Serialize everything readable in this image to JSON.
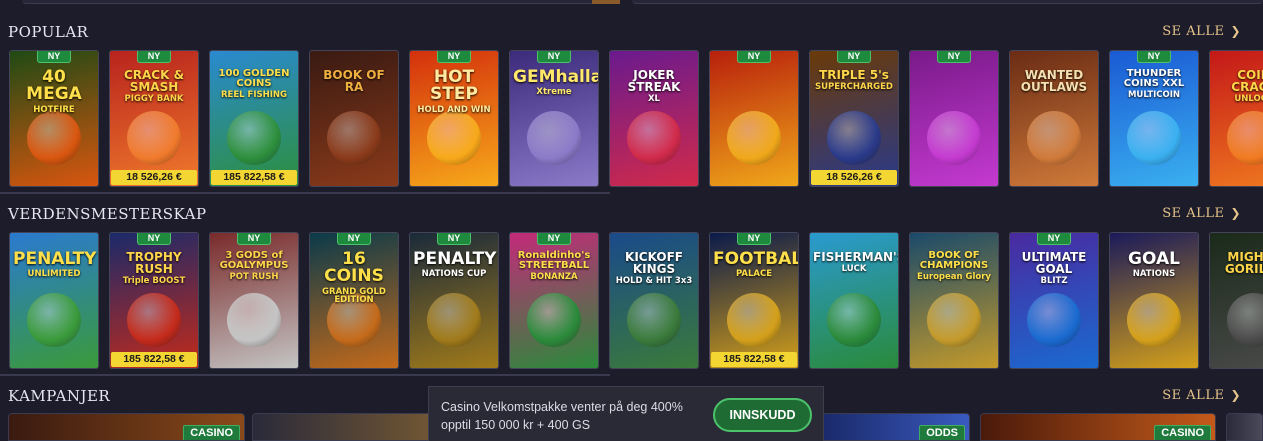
{
  "sections": {
    "popular": {
      "title": "POPULAR",
      "see_all": "SE ALLE"
    },
    "world_cup": {
      "title": "VERDENSMESTERSKAP",
      "see_all": "SE ALLE"
    },
    "promotions": {
      "title": "KAMPANJER",
      "see_all": "SE ALLE"
    }
  },
  "new_badge": "NY",
  "popular_games": [
    {
      "name": "40 MEGA",
      "sub": "HOTFIRE",
      "new": true,
      "jackpot": "",
      "bg": "#1f4a14",
      "bg2": "#d9560f",
      "fg": "#ffe04a"
    },
    {
      "name": "CRACK & SMASH",
      "sub": "PIGGY BANK",
      "new": true,
      "jackpot": "18 526,26 €",
      "bg": "#b8231d",
      "bg2": "#f07a2c",
      "fg": "#ffd64a"
    },
    {
      "name": "100 GOLDEN COINS",
      "sub": "REEL FISHING",
      "new": false,
      "jackpot": "185 822,58 €",
      "bg": "#2a8ad0",
      "bg2": "#2d8f3c",
      "fg": "#ffe04a"
    },
    {
      "name": "BOOK OF RA",
      "sub": "",
      "new": false,
      "jackpot": "",
      "bg": "#3a1a12",
      "bg2": "#8a3a1a",
      "fg": "#f0b040"
    },
    {
      "name": "HOT STEP",
      "sub": "HOLD AND WIN",
      "new": true,
      "jackpot": "",
      "bg": "#d4300c",
      "bg2": "#f7a91a",
      "fg": "#ffeaa0"
    },
    {
      "name": "GEMhalla",
      "sub": "Xtreme",
      "new": true,
      "jackpot": "",
      "bg": "#3c2a7a",
      "bg2": "#8a7ac8",
      "fg": "#ffe86a"
    },
    {
      "name": "JOKER STREAK",
      "sub": "XL",
      "new": false,
      "jackpot": "",
      "bg": "#6a1a8e",
      "bg2": "#d12a4a",
      "fg": "#ffffff"
    },
    {
      "name": "",
      "sub": "",
      "new": true,
      "jackpot": "",
      "bg": "#b8200c",
      "bg2": "#f0a81a",
      "fg": "#ffd64a"
    },
    {
      "name": "TRIPLE 5's",
      "sub": "SUPERCHARGED",
      "new": true,
      "jackpot": "18 526,26 €",
      "bg": "#6a3a08",
      "bg2": "#2a3a8a",
      "fg": "#ffd64a"
    },
    {
      "name": "",
      "sub": "",
      "new": true,
      "jackpot": "",
      "bg": "#7a1a8a",
      "bg2": "#c43ad0",
      "fg": "#ffffff"
    },
    {
      "name": "WANTED OUTLAWS",
      "sub": "",
      "new": false,
      "jackpot": "",
      "bg": "#6a2c14",
      "bg2": "#d07a3a",
      "fg": "#f4e0b0"
    },
    {
      "name": "THUNDER COINS XXL",
      "sub": "MULTICOIN",
      "new": true,
      "jackpot": "",
      "bg": "#1a5ad4",
      "bg2": "#3ab0f0",
      "fg": "#ffffff"
    },
    {
      "name": "COIN CRACK",
      "sub": "UNLOCK",
      "new": false,
      "jackpot": "",
      "bg": "#c41818",
      "bg2": "#f07a20",
      "fg": "#ffd64a"
    }
  ],
  "world_cup_games": [
    {
      "name": "PENALTY",
      "sub": "UNLIMITED",
      "new": false,
      "jackpot": "",
      "bg": "#2a7ad0",
      "bg2": "#3a9a3a",
      "fg": "#ffe04a"
    },
    {
      "name": "TROPHY RUSH",
      "sub": "Triple BOOST",
      "new": true,
      "jackpot": "185 822,58 €",
      "bg": "#1a2a6a",
      "bg2": "#c42a1a",
      "fg": "#ffd64a"
    },
    {
      "name": "3 GODS of GOALYMPUS",
      "sub": "POT RUSH",
      "new": true,
      "jackpot": "",
      "bg": "#7a2a2a",
      "bg2": "#c4c4c4",
      "fg": "#ffd64a"
    },
    {
      "name": "16 COINS",
      "sub": "GRAND GOLD EDITION",
      "new": true,
      "jackpot": "",
      "bg": "#0a3a4a",
      "bg2": "#c46a1a",
      "fg": "#ffe04a"
    },
    {
      "name": "PENALTY",
      "sub": "NATIONS CUP",
      "new": true,
      "jackpot": "",
      "bg": "#1a2a3a",
      "bg2": "#a07a1a",
      "fg": "#ffffff"
    },
    {
      "name": "Ronaldinho's STREETBALL",
      "sub": "BONANZA",
      "new": true,
      "jackpot": "",
      "bg": "#c42a7a",
      "bg2": "#2a8a3a",
      "fg": "#ffe04a"
    },
    {
      "name": "KICKOFF KINGS",
      "sub": "HOLD & HIT 3x3",
      "new": false,
      "jackpot": "",
      "bg": "#1a4a8a",
      "bg2": "#3a7a3a",
      "fg": "#ffffff"
    },
    {
      "name": "FOOTBALL",
      "sub": "PALACE",
      "new": true,
      "jackpot": "185 822,58 €",
      "bg": "#0a1a4a",
      "bg2": "#d4a01a",
      "fg": "#ffe04a"
    },
    {
      "name": "FISHERMAN'S",
      "sub": "LUCK",
      "new": false,
      "jackpot": "",
      "bg": "#2a9ad0",
      "bg2": "#2a8a3a",
      "fg": "#ffffff"
    },
    {
      "name": "BOOK OF CHAMPIONS",
      "sub": "European Glory",
      "new": false,
      "jackpot": "",
      "bg": "#1a4a6a",
      "bg2": "#c49a2a",
      "fg": "#ffe04a"
    },
    {
      "name": "ULTIMATE GOAL",
      "sub": "BLITZ",
      "new": true,
      "jackpot": "",
      "bg": "#4a2aa0",
      "bg2": "#1a6ad0",
      "fg": "#ffffff"
    },
    {
      "name": "GOAL",
      "sub": "NATIONS",
      "new": false,
      "jackpot": "",
      "bg": "#1a1a5a",
      "bg2": "#d4a01a",
      "fg": "#ffffff"
    },
    {
      "name": "MIGHTY GORILLA",
      "sub": "",
      "new": false,
      "jackpot": "",
      "bg": "#1a2a1a",
      "bg2": "#4a4a4a",
      "fg": "#ffd64a"
    }
  ],
  "promotions": [
    {
      "badge": "CASINO",
      "bg": "#3a1a10",
      "bg2": "#8a4a1a"
    },
    {
      "badge": "",
      "bg": "#2a2a3a",
      "bg2": "#c48a2a"
    },
    {
      "badge": "ODDS",
      "bg": "#1a2a6a",
      "bg2": "#3a5ac0"
    },
    {
      "badge": "CASINO",
      "bg": "#4a1a0a",
      "bg2": "#c45a1a"
    },
    {
      "badge": "",
      "bg": "#2a2a3a",
      "bg2": "#4a4a5a"
    }
  ],
  "welcome_toast": {
    "message": "Casino Velkomstpakke venter på deg 400% opptil 150 000 kr + 400 GS",
    "button": "INNSKUDD"
  }
}
